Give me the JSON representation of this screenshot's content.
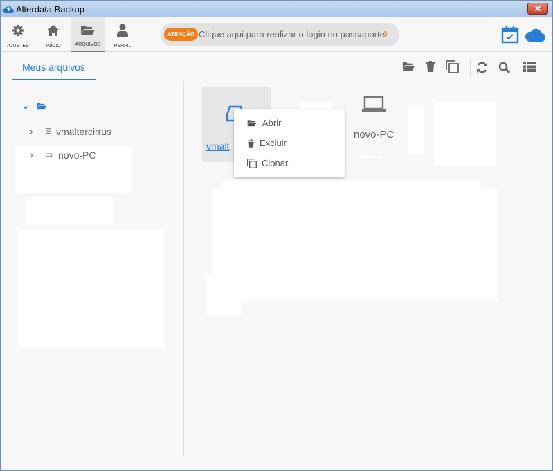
{
  "window": {
    "title": "Alterdata Backup",
    "close": "✕"
  },
  "nav": [
    {
      "label": "AJUSTES",
      "icon": "gear-icon"
    },
    {
      "label": "INÍCIO",
      "icon": "home-icon"
    },
    {
      "label": "ARQUIVOS",
      "icon": "folder-open-icon",
      "active": true
    },
    {
      "label": "PERFIL",
      "icon": "user-icon"
    }
  ],
  "banner": {
    "badge": "ATENÇÃO",
    "message": "Clique aqui para realizar o login no passaporte",
    "arrow": "›"
  },
  "tabs": {
    "my_files": "Meus arquivos"
  },
  "tree": {
    "root_expand": "⌄",
    "items": [
      {
        "label": "vmaltercirrus",
        "icon": "drive-icon"
      },
      {
        "label": "novo-PC",
        "icon": "laptop-icon"
      }
    ]
  },
  "files": [
    {
      "label": "vmalt",
      "icon": "drive-icon",
      "selected": true
    },
    {
      "label": "novo-PC",
      "icon": "laptop-icon"
    }
  ],
  "context_menu": [
    {
      "label": "Abrir",
      "icon": "folder-open-icon"
    },
    {
      "label": "Excluir",
      "icon": "trash-icon"
    },
    {
      "label": "Clonar",
      "icon": "clone-icon"
    }
  ],
  "colors": {
    "accent": "#2a7fd4",
    "badge": "#f07d1a"
  }
}
